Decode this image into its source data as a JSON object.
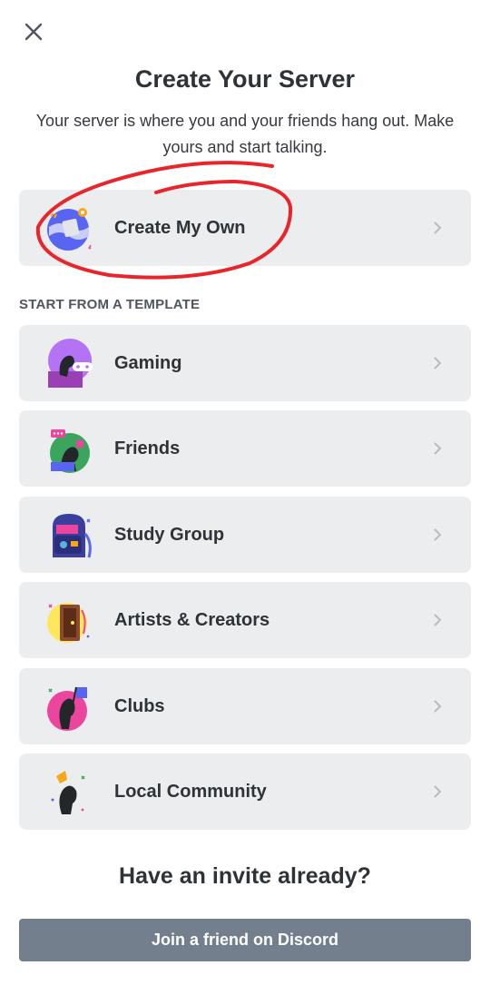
{
  "header": {
    "close_icon": "close-icon",
    "title": "Create Your Server",
    "subtitle": "Your server is where you and your friends hang out. Make yours and start talking."
  },
  "create_own": {
    "label": "Create My Own",
    "icon": "globe-illustration-icon"
  },
  "templates": {
    "section_label": "START FROM A TEMPLATE",
    "items": [
      {
        "label": "Gaming",
        "icon": "gaming-illustration-icon"
      },
      {
        "label": "Friends",
        "icon": "friends-illustration-icon"
      },
      {
        "label": "Study Group",
        "icon": "backpack-illustration-icon"
      },
      {
        "label": "Artists & Creators",
        "icon": "artists-illustration-icon"
      },
      {
        "label": "Clubs",
        "icon": "clubs-illustration-icon"
      },
      {
        "label": "Local Community",
        "icon": "community-illustration-icon"
      }
    ]
  },
  "invite": {
    "title": "Have an invite already?",
    "button_label": "Join a friend on Discord"
  },
  "colors": {
    "card_bg": "#ebedef",
    "button_bg": "#747f8d",
    "annotation": "#e8252b",
    "text_primary": "#2e3338"
  }
}
